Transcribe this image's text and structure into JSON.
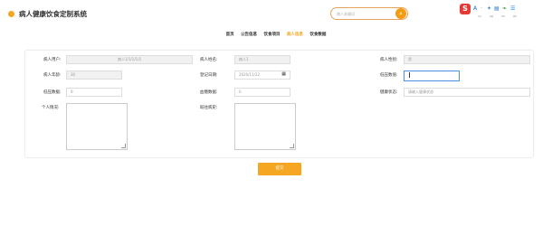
{
  "header": {
    "title": "病人健康饮食定制系统",
    "search_placeholder": "病人关键词",
    "search_icon": "search-icon"
  },
  "toolbar": {
    "ext_labels": [
      "A",
      "·",
      "✦",
      "▤",
      "❧",
      "☰"
    ],
    "sub_labels": [
      "中文",
      "设置",
      "语言",
      "插件"
    ]
  },
  "nav": {
    "items": [
      {
        "label": "首页",
        "active": false
      },
      {
        "label": "公告信息",
        "active": false
      },
      {
        "label": "饮食项目",
        "active": false
      },
      {
        "label": "病人信息",
        "active": true
      },
      {
        "label": "饮食数据",
        "active": false
      }
    ]
  },
  "form": {
    "fields": {
      "patient_account": {
        "label": "病人用户:",
        "value": "病人1/1/1/1/1"
      },
      "patient_name": {
        "label": "病人姓名:",
        "value": "病人1"
      },
      "patient_gender": {
        "label": "病人性别:",
        "value": "男"
      },
      "patient_age": {
        "label": "病人年龄:",
        "value": "30"
      },
      "register_date": {
        "label": "登记日期:",
        "value": "2020/11/22"
      },
      "blood_pressure_status": {
        "label": "低压数值:",
        "value": ""
      },
      "low_pressure": {
        "label": "低压数据:",
        "value": "9"
      },
      "blood_sugar": {
        "label": "血糖数据:",
        "value": "0"
      },
      "health_status": {
        "label": "健康状态:",
        "value": "",
        "placeholder": "请输入健康状态"
      },
      "personal_habits": {
        "label": "个人情况:"
      },
      "past_history": {
        "label": "既往病史:"
      }
    },
    "submit_label": "提交"
  }
}
